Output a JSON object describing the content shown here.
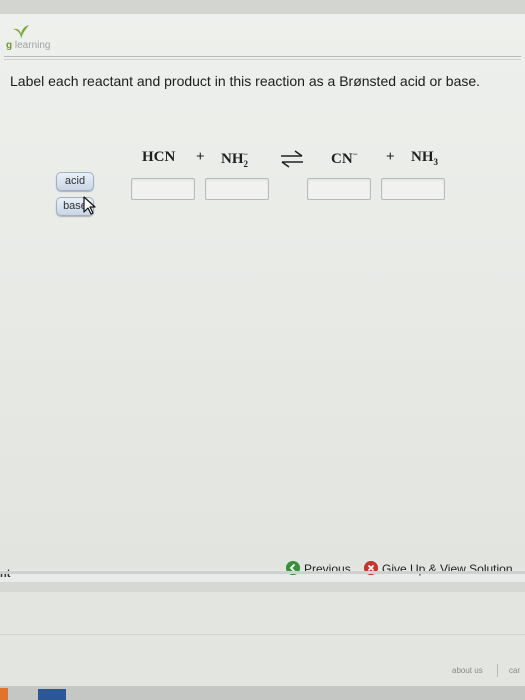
{
  "brand": {
    "prefix": "g",
    "name": "learning",
    "brand_color": "#6a9a2f"
  },
  "question": {
    "text": "Label each reactant and product in this reaction as a Brønsted acid or base."
  },
  "equation": {
    "reactant1": "HCN",
    "plus1": "+",
    "reactant2_base": "NH",
    "reactant2_sub": "2",
    "reactant2_sup": "−",
    "arrow": "⇌",
    "product1_base": "CN",
    "product1_sup": "−",
    "plus2": "+",
    "product2_base": "NH",
    "product2_sub": "3"
  },
  "chips": [
    {
      "label": "acid"
    },
    {
      "label": "base"
    }
  ],
  "drop_targets": [
    {
      "for": "HCN",
      "value": ""
    },
    {
      "for": "NH2-",
      "value": ""
    },
    {
      "for": "CN-",
      "value": ""
    },
    {
      "for": "NH3",
      "value": ""
    }
  ],
  "actions": {
    "previous_label": "Previous",
    "give_up_label": "Give Up & View Solution"
  },
  "left_fragment": "nt",
  "footer": {
    "about_label": "about us",
    "next_fragment": "car"
  },
  "icons": {
    "previous": "previous-arrow-icon",
    "give_up": "give-up-x-icon",
    "cursor": "mouse-cursor-icon",
    "leaf": "leaf-logo-icon"
  },
  "colors": {
    "accent_green": "#3b8f3d",
    "accent_red": "#c8352b",
    "chip_blue": "#c9d6e6"
  }
}
